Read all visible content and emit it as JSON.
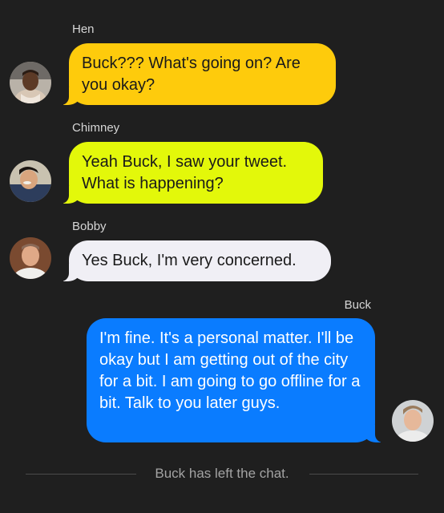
{
  "chat": {
    "messages": [
      {
        "sender": "Hen",
        "text": "Buck??? What's going on? Are you okay?",
        "bubble_color": "#fecb0c",
        "text_color": "#1a1a1a",
        "avatar_icon": "person-avatar-icon"
      },
      {
        "sender": "Chimney",
        "text": "Yeah Buck, I saw your tweet. What is happening?",
        "bubble_color": "#e3f80a",
        "text_color": "#1a1a1a",
        "avatar_icon": "person-avatar-icon"
      },
      {
        "sender": "Bobby",
        "text": "Yes Buck, I'm very concerned.",
        "bubble_color": "#f0eff5",
        "text_color": "#1a1a1a",
        "avatar_icon": "person-avatar-icon"
      },
      {
        "sender": "Buck",
        "text": "I'm fine. It's a personal matter. I'll be okay but I am getting out of the city for a bit. I am going to go offline for a bit. Talk to you later guys.",
        "bubble_color": "#0a7cff",
        "text_color": "#ffffff",
        "avatar_icon": "person-avatar-icon"
      }
    ],
    "system_message": "Buck has left the chat."
  },
  "colors": {
    "background": "#1f1f1f",
    "sender_label": "#d6d6d6",
    "system_text": "#a3a3a3",
    "divider": "#4a4a4a"
  }
}
